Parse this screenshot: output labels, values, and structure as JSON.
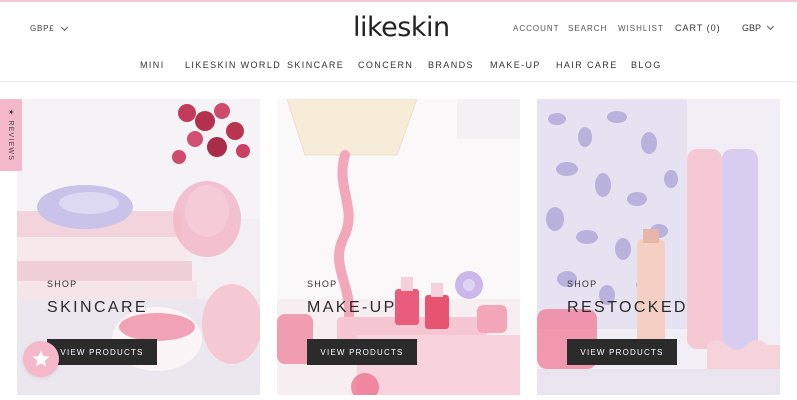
{
  "header": {
    "currency_left": "GBP£",
    "logo": "likeskin",
    "account": "ACCOUNT",
    "search": "SEARCH",
    "wishlist": "WISHLIST",
    "cart": "CART (0)",
    "currency_right": "GBP"
  },
  "nav": [
    "MINI",
    "LIKESKIN WORLD",
    "SKINCARE",
    "CONCERN",
    "BRANDS",
    "MAKE-UP",
    "HAIR CARE",
    "BLOG"
  ],
  "reviews": {
    "label": "REVIEWS"
  },
  "cards": [
    {
      "eyebrow": "SHOP",
      "title": "SKINCARE",
      "button": "VIEW PRODUCTS"
    },
    {
      "eyebrow": "SHOP",
      "title": "MAKE-UP",
      "button": "VIEW PRODUCTS"
    },
    {
      "eyebrow": "SHOP",
      "title": "RESTOCKED",
      "button": "VIEW PRODUCTS"
    }
  ],
  "colors": {
    "accent_pink": "#f4b8ca",
    "button_dark": "#2b2b2b",
    "header_rule": "#f4c6d2"
  }
}
